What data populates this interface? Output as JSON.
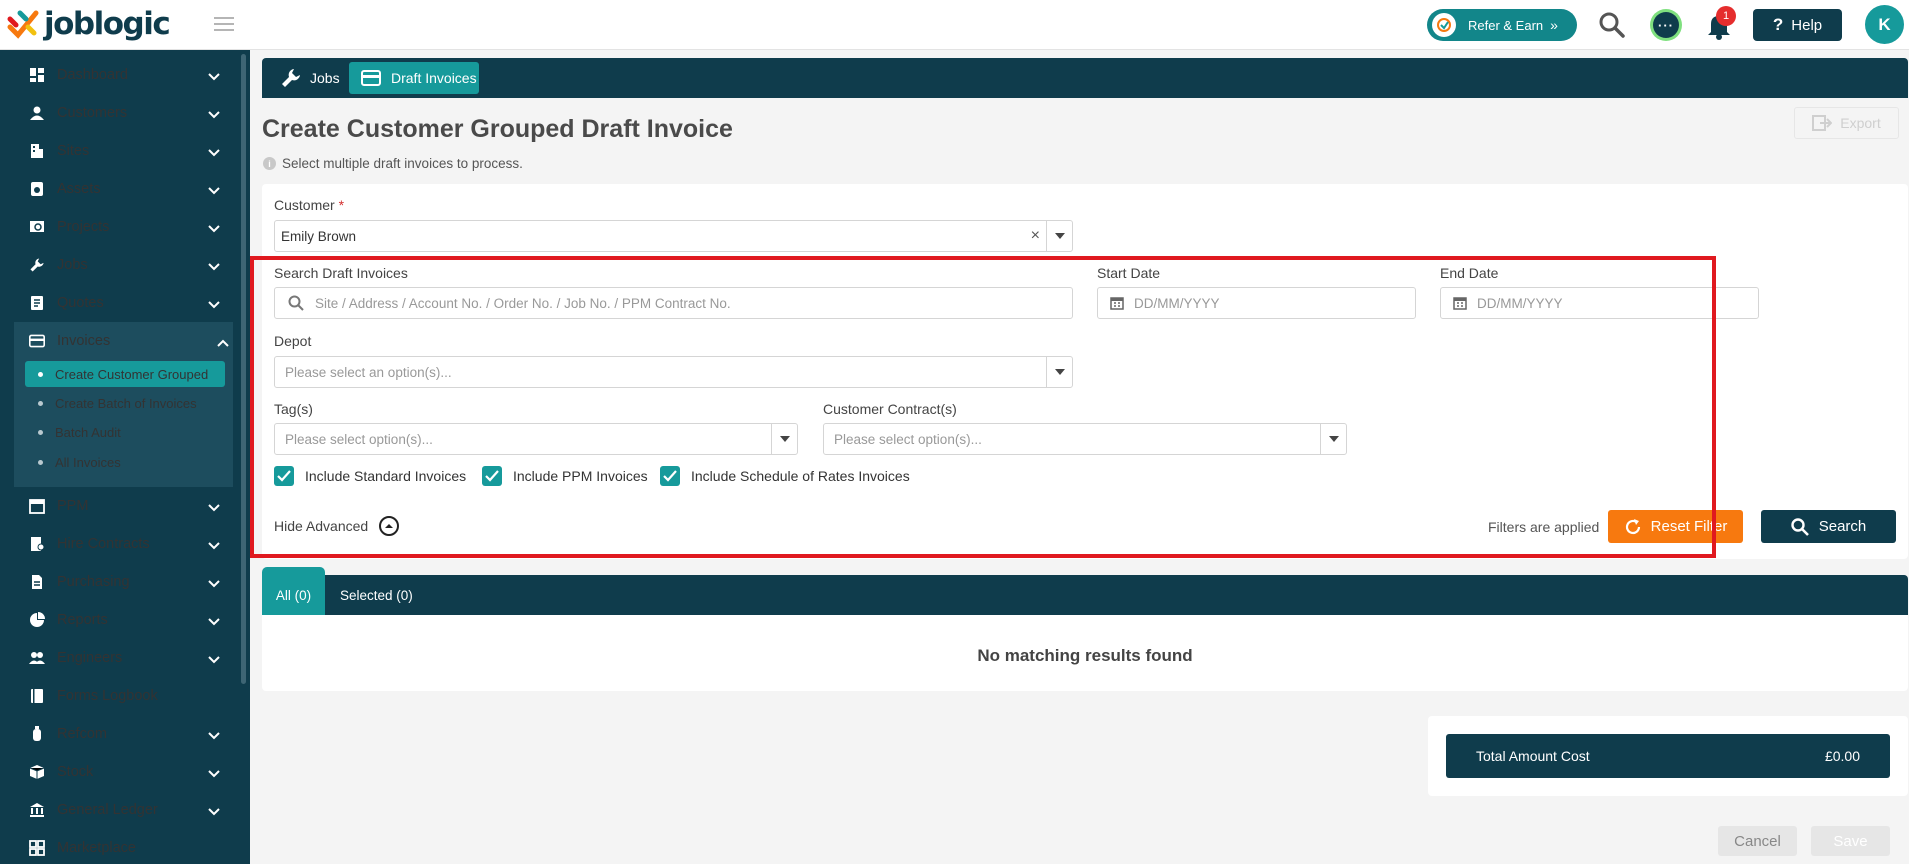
{
  "brand": {
    "name": "joblogic"
  },
  "topbar": {
    "refer_label": "Refer & Earn",
    "notification_count": "1",
    "help_label": "Help",
    "avatar_initial": "K"
  },
  "sidebar": {
    "items": [
      {
        "label": "Dashboard",
        "icon": "dashboard-icon"
      },
      {
        "label": "Customers",
        "icon": "person-icon"
      },
      {
        "label": "Sites",
        "icon": "building-icon"
      },
      {
        "label": "Assets",
        "icon": "asset-icon"
      },
      {
        "label": "Projects",
        "icon": "projects-icon"
      },
      {
        "label": "Jobs",
        "icon": "wrench-icon"
      },
      {
        "label": "Quotes",
        "icon": "quote-icon"
      },
      {
        "label": "Invoices",
        "icon": "invoice-icon"
      },
      {
        "label": "PPM",
        "icon": "calendar-icon"
      },
      {
        "label": "Hire Contracts",
        "icon": "contract-icon"
      },
      {
        "label": "Purchasing",
        "icon": "document-icon"
      },
      {
        "label": "Reports",
        "icon": "pie-chart-icon"
      },
      {
        "label": "Engineers",
        "icon": "people-icon"
      },
      {
        "label": "Forms Logbook",
        "icon": "book-icon"
      },
      {
        "label": "Refcom",
        "icon": "cylinder-icon"
      },
      {
        "label": "Stock",
        "icon": "box-icon"
      },
      {
        "label": "General Ledger",
        "icon": "bank-icon"
      },
      {
        "label": "Marketplace",
        "icon": "grid-icon"
      }
    ],
    "invoices_sub": [
      {
        "label": "Create Customer Grouped"
      },
      {
        "label": "Create Batch of Invoices"
      },
      {
        "label": "Batch Audit"
      },
      {
        "label": "All Invoices"
      }
    ]
  },
  "breadcrumb": {
    "jobs": "Jobs",
    "draft_invoices": "Draft Invoices"
  },
  "page": {
    "title": "Create Customer Grouped Draft Invoice",
    "subtitle": "Select multiple draft invoices to process.",
    "export_label": "Export"
  },
  "form": {
    "customer_label": "Customer",
    "customer_required": "*",
    "customer_value": "Emily Brown",
    "search_label": "Search Draft Invoices",
    "search_placeholder": "Site / Address / Account No. / Order No. / Job No. / PPM Contract No.",
    "start_date_label": "Start Date",
    "start_date_placeholder": "DD/MM/YYYY",
    "end_date_label": "End Date",
    "end_date_placeholder": "DD/MM/YYYY",
    "depot_label": "Depot",
    "depot_placeholder": "Please select an option(s)...",
    "tags_label": "Tag(s)",
    "tags_placeholder": "Please select option(s)...",
    "contracts_label": "Customer Contract(s)",
    "contracts_placeholder": "Please select option(s)...",
    "checkboxes": [
      {
        "label": "Include Standard Invoices",
        "checked": true
      },
      {
        "label": "Include PPM Invoices",
        "checked": true
      },
      {
        "label": "Include Schedule of Rates Invoices",
        "checked": true
      }
    ],
    "hide_advanced": "Hide Advanced",
    "filters_applied": "Filters are applied",
    "reset_label": "Reset Filter",
    "search_label_btn": "Search"
  },
  "results": {
    "tab_all": "All (0)",
    "tab_selected": "Selected (0)",
    "empty_message": "No matching results found"
  },
  "totals": {
    "label": "Total Amount Cost",
    "value": "£0.00"
  },
  "footer": {
    "cancel": "Cancel",
    "save": "Save"
  },
  "colors": {
    "navy": "#0f3c4c",
    "teal": "#169a9b",
    "orange": "#f7790f",
    "highlight_red": "#e0191f"
  }
}
